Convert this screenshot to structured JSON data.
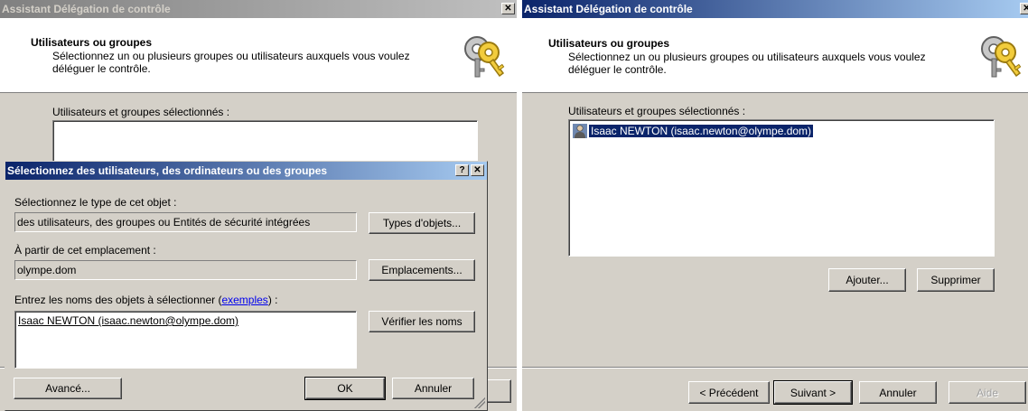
{
  "left_window": {
    "title": "Assistant Délégation de contrôle",
    "header_title": "Utilisateurs ou groupes",
    "header_subtitle": "Sélectionnez un ou plusieurs groupes ou utilisateurs auxquels vous voulez déléguer le contrôle.",
    "list_label": "Utilisateurs et groupes sélectionnés :",
    "close_glyph": "✕"
  },
  "dialog": {
    "title": "Sélectionnez des utilisateurs, des ordinateurs ou des groupes",
    "help_glyph": "?",
    "close_glyph": "✕",
    "type_label": "Sélectionnez le type de cet objet :",
    "type_value": "des utilisateurs, des groupes ou Entités de sécurité intégrées",
    "types_button": "Types d'objets...",
    "location_label": "À partir de cet emplacement :",
    "location_value": "olympe.dom",
    "locations_button": "Emplacements...",
    "names_label_prefix": "Entrez les noms des objets à sélectionner (",
    "names_label_link": "exemples",
    "names_label_suffix": ") :",
    "names_value": "Isaac NEWTON (isaac.newton@olympe.dom)",
    "check_names_button": "Vérifier les noms",
    "advanced_button": "Avancé...",
    "ok_button": "OK",
    "cancel_button": "Annuler"
  },
  "right_window": {
    "title": "Assistant Délégation de contrôle",
    "close_glyph": "✕",
    "header_title": "Utilisateurs ou groupes",
    "header_subtitle": "Sélectionnez un ou plusieurs groupes ou utilisateurs auxquels vous voulez déléguer le contrôle.",
    "list_label": "Utilisateurs et groupes sélectionnés :",
    "selected_items": [
      "Isaac NEWTON (isaac.newton@olympe.dom)"
    ],
    "add_button": "Ajouter...",
    "remove_button": "Supprimer",
    "back_button": "< Précédent",
    "next_button": "Suivant >",
    "cancel_button": "Annuler",
    "help_button": "Aide"
  },
  "icons": {
    "wizard": "keys-icon",
    "user": "user-icon"
  },
  "colors": {
    "active_title": "#0a246a",
    "inactive_title": "#808080",
    "selection": "#0a246a",
    "face": "#d4d0c8"
  }
}
